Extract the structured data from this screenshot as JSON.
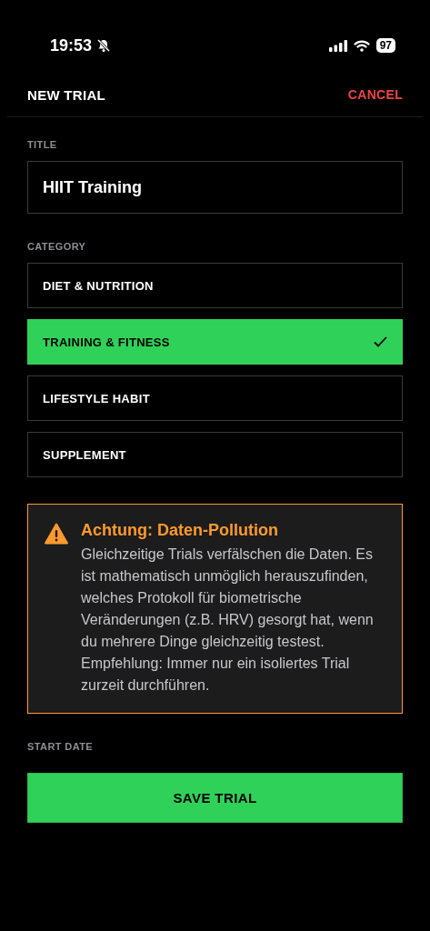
{
  "status_bar": {
    "time": "19:53",
    "silent": true,
    "battery": "97"
  },
  "header": {
    "title": "NEW TRIAL",
    "cancel": "CANCEL"
  },
  "title_field": {
    "label": "TITLE",
    "value": "HIIT Training"
  },
  "category": {
    "label": "CATEGORY",
    "options": [
      {
        "label": "DIET & NUTRITION",
        "selected": false
      },
      {
        "label": "TRAINING & FITNESS",
        "selected": true
      },
      {
        "label": "LIFESTYLE HABIT",
        "selected": false
      },
      {
        "label": "SUPPLEMENT",
        "selected": false
      }
    ]
  },
  "warning": {
    "title": "Achtung: Daten-Pollution",
    "text": "Gleichzeitige Trials verfälschen die Daten. Es ist mathematisch unmöglich herauszufinden, welches Protokoll für biometrische Veränderungen (z.B. HRV) gesorgt hat, wenn du mehrere Dinge gleichzeitig testest. Empfehlung: Immer nur ein isoliertes Trial zurzeit durchführen."
  },
  "start_date": {
    "label": "START DATE"
  },
  "save_button": "SAVE TRIAL"
}
